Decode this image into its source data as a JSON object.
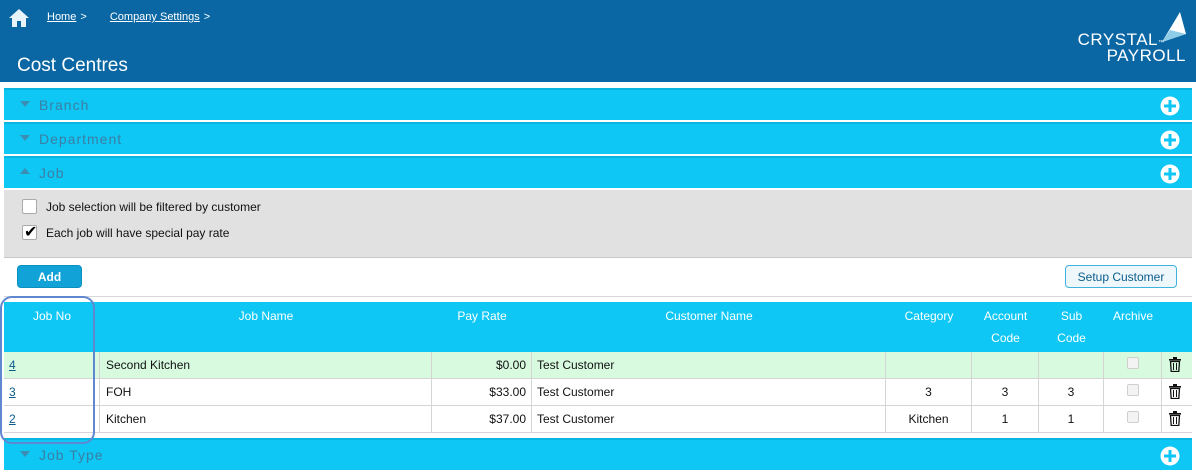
{
  "breadcrumb": {
    "home": "Home",
    "company_settings": "Company Settings",
    "sep": ">"
  },
  "page_title": "Cost Centres",
  "logo": {
    "line1": "CRYSTAL",
    "line2": "PAYROLL",
    "mark": "™"
  },
  "sections": {
    "branch": "Branch",
    "department": "Department",
    "job": "Job",
    "job_type": "Job Type"
  },
  "job_options": {
    "filter_by_customer": {
      "label": "Job selection will be filtered by customer",
      "checked": false
    },
    "special_pay_rate": {
      "label": "Each job will have special pay rate",
      "checked": true
    }
  },
  "buttons": {
    "add": "Add",
    "setup_customer": "Setup Customer"
  },
  "table": {
    "headers": {
      "job_no": "Job No",
      "job_name": "Job Name",
      "pay_rate": "Pay Rate",
      "customer_name": "Customer Name",
      "category": "Category",
      "account_code_1": "Account",
      "account_code_2": "Code",
      "sub_code_1": "Sub",
      "sub_code_2": "Code",
      "archive": "Archive"
    },
    "rows": [
      {
        "job_no": "4",
        "job_name": "Second Kitchen",
        "pay_rate": "$0.00",
        "customer_name": "Test Customer",
        "category": "",
        "account_code": "",
        "sub_code": "",
        "archived": false
      },
      {
        "job_no": "3",
        "job_name": "FOH",
        "pay_rate": "$33.00",
        "customer_name": "Test Customer",
        "category": "3",
        "account_code": "3",
        "sub_code": "3",
        "archived": false
      },
      {
        "job_no": "2",
        "job_name": "Kitchen",
        "pay_rate": "$37.00",
        "customer_name": "Test Customer",
        "category": "Kitchen",
        "account_code": "1",
        "sub_code": "1",
        "archived": false
      }
    ]
  },
  "colors": {
    "header": "#0a67a4",
    "accent": "#0ec7f5",
    "highlight_row": "#d8fbe0"
  }
}
